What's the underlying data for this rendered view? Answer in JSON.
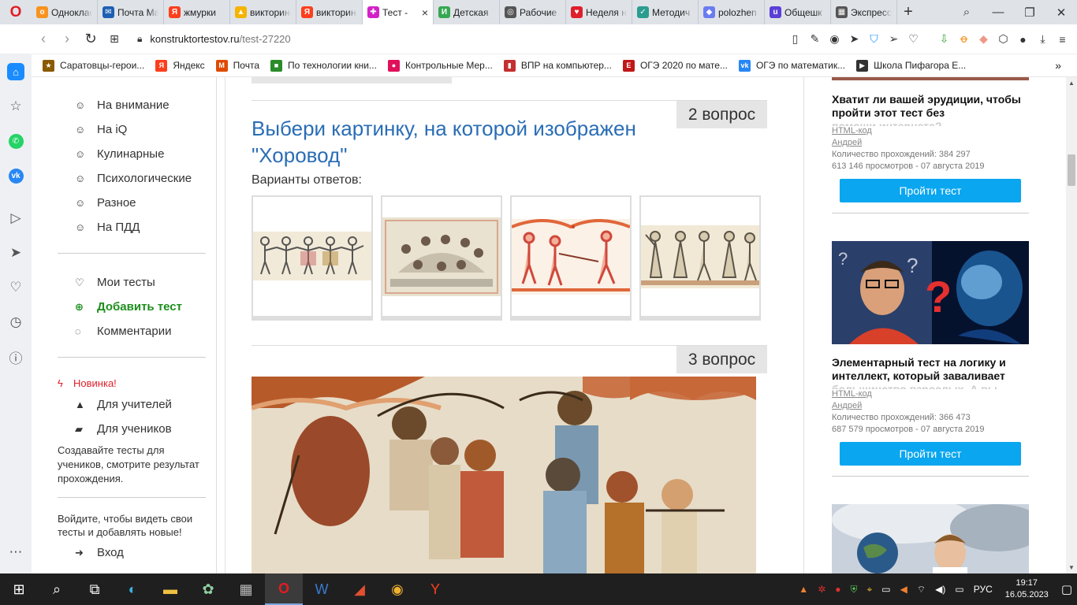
{
  "tabs": [
    {
      "title": "Одноклассники",
      "fav": "ok",
      "color": "#f7931e"
    },
    {
      "title": "Почта Mail.ru",
      "fav": "mail",
      "color": "#1e5fb4"
    },
    {
      "title": "жмурки",
      "fav": "ya",
      "color": "#fc3f1d"
    },
    {
      "title": "викторина",
      "fav": "img",
      "color": "#f5b400"
    },
    {
      "title": "викторина",
      "fav": "ya",
      "color": "#fc3f1d"
    },
    {
      "title": "Тест - ",
      "fav": "puzzle",
      "color": "#d321c8",
      "active": true
    },
    {
      "title": "Детская",
      "fav": "doc",
      "color": "#36a852"
    },
    {
      "title": "Рабочие",
      "fav": "globe",
      "color": "#555555"
    },
    {
      "title": "Неделя н",
      "fav": "heart",
      "color": "#e01e2b"
    },
    {
      "title": "Методич",
      "fav": "check",
      "color": "#2a9d8f"
    },
    {
      "title": "polozhen",
      "fav": "cube",
      "color": "#6b7cf0"
    },
    {
      "title": "Общешк",
      "fav": "u",
      "color": "#5b3fd6"
    },
    {
      "title": "Экспресс",
      "fav": "grid",
      "color": "#555555"
    }
  ],
  "address": {
    "domain": "konstruktortestov.ru",
    "path": "/test-27220"
  },
  "bookmarks": [
    {
      "label": "Саратовцы-герои...",
      "color": "#8a5a00",
      "icon": "★"
    },
    {
      "label": "Яндекс",
      "color": "#fc3f1d",
      "icon": "Я"
    },
    {
      "label": "Почта",
      "color": "#e04a00",
      "icon": "M"
    },
    {
      "label": "По технологии кни...",
      "color": "#2a8c2a",
      "icon": "■"
    },
    {
      "label": "Контрольные Мер...",
      "color": "#e0105a",
      "icon": "●"
    },
    {
      "label": "ВПР на компьютер...",
      "color": "#c43030",
      "icon": "▮"
    },
    {
      "label": "ОГЭ 2020 по мате...",
      "color": "#c01818",
      "icon": "E"
    },
    {
      "label": "ОГЭ по математик...",
      "color": "#2787f5",
      "icon": "vk"
    },
    {
      "label": "Школа Пифагора Е...",
      "color": "#333333",
      "icon": "▶"
    }
  ],
  "leftnav": {
    "categories": [
      "На внимание",
      "На iQ",
      "Кулинарные",
      "Психологические",
      "Разное",
      "На ПДД"
    ],
    "my_tests": "Мои тесты",
    "add_test": "Добавить тест",
    "comments": "Комментарии",
    "new_label": "Новинка!",
    "for_teachers": "Для учителей",
    "for_students": "Для учеников",
    "promo": "Создавайте тесты для учеников, смотрите результат прохождения.",
    "login_prompt": "Войдите, чтобы видеть свои тесты и добавлять новые!",
    "login": "Вход"
  },
  "question2": {
    "badge": "2 вопрос",
    "title": "Выбери картинку, на которой изображен \"Хоровод\"",
    "answers_label": "Варианты ответов:"
  },
  "question3": {
    "badge": "3 вопрос"
  },
  "rightcol": {
    "card1": {
      "title": "Хватит ли вашей эрудиции, чтобы пройти этот тест без",
      "faded": "помощи интернета?",
      "html_link": "HTML-код",
      "author": "Андрей",
      "passes": "Количество прохождений: 384 297",
      "views": "613 146 просмотров - 07 августа 2019",
      "button": "Пройти тест"
    },
    "card2": {
      "title": "Элементарный тест на логику и интеллект, который заваливает",
      "faded": "большинство взрослых. А вы",
      "html_link": "HTML-код",
      "author": "Андрей",
      "passes": "Количество прохождений: 366 473",
      "views": "687 579 просмотров - 07 августа 2019",
      "button": "Пройти тест"
    }
  },
  "taskbar": {
    "lang": "РУС",
    "time": "19:17",
    "date": "16.05.2023"
  }
}
